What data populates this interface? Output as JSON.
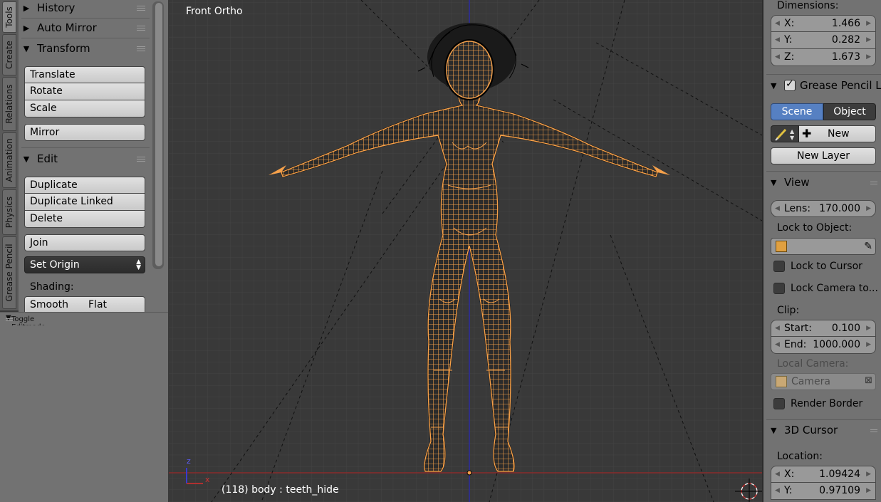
{
  "tool_tabs": [
    "Tools",
    "Create",
    "Relations",
    "Animation",
    "Physics",
    "Grease Pencil"
  ],
  "active_tab": "Tools",
  "tool_shelf": {
    "history": "History",
    "auto_mirror": "Auto Mirror",
    "transform": {
      "header": "Transform",
      "buttons": [
        "Translate",
        "Rotate",
        "Scale"
      ],
      "mirror": "Mirror"
    },
    "edit": {
      "header": "Edit",
      "buttons": [
        "Duplicate",
        "Duplicate Linked",
        "Delete"
      ],
      "join": "Join",
      "set_origin": "Set Origin"
    },
    "shading": {
      "label": "Shading:",
      "smooth": "Smooth",
      "flat": "Flat"
    }
  },
  "operator_panel": {
    "title": "Toggle Editmode"
  },
  "viewport": {
    "title": "Front Ortho",
    "status": "(118) body : teeth_hide",
    "axis_x": "x",
    "axis_z": "z"
  },
  "properties": {
    "dimensions": {
      "label": "Dimensions:",
      "x": {
        "label": "X:",
        "value": "1.466"
      },
      "y": {
        "label": "Y:",
        "value": "0.282"
      },
      "z": {
        "label": "Z:",
        "value": "1.673"
      }
    },
    "grease_pencil": {
      "header": "Grease Pencil L",
      "enabled": true,
      "scene": "Scene",
      "object": "Object",
      "active_source": "Scene",
      "new": "New",
      "new_layer": "New Layer"
    },
    "view": {
      "header": "View",
      "lens": {
        "label": "Lens:",
        "value": "170.000"
      },
      "lock_to_object": "Lock to Object:",
      "lock_to_cursor": "Lock to Cursor",
      "lock_camera": "Lock Camera to...",
      "clip": "Clip:",
      "start": {
        "label": "Start:",
        "value": "0.100"
      },
      "end": {
        "label": "End:",
        "value": "1000.000"
      },
      "local_camera": "Local Camera:",
      "camera": "Camera",
      "render_border": "Render Border"
    },
    "cursor3d": {
      "header": "3D Cursor",
      "location": "Location:",
      "x": {
        "label": "X:",
        "value": "1.09424"
      },
      "y": {
        "label": "Y:",
        "value": "0.97109"
      }
    }
  },
  "colors": {
    "wire": "#f5a04a",
    "hair": "#111111",
    "active_toggle": "#5680c2",
    "axis_x": "#b03030",
    "axis_z": "#3a3ad0"
  },
  "icons": [
    "tools-tab-icon",
    "pencil-icon",
    "plus-icon",
    "cube-icon",
    "eyedropper-icon",
    "clear-icon",
    "cursor-icon",
    "grip-icon"
  ]
}
